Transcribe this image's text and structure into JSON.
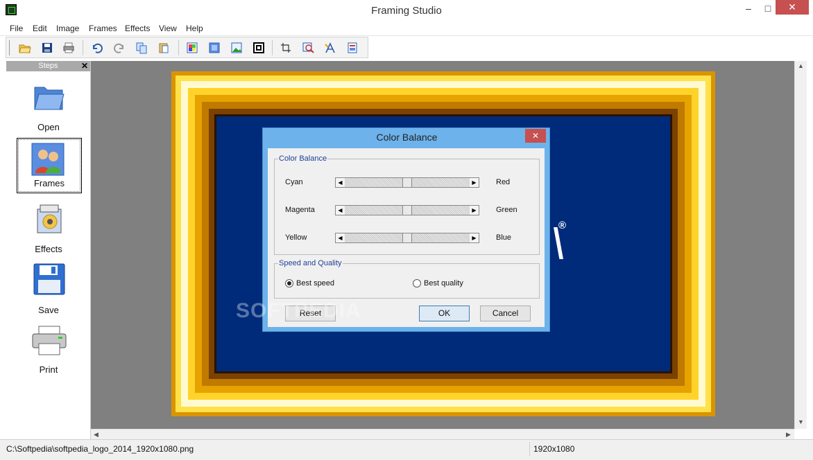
{
  "window": {
    "title": "Framing Studio",
    "min_glyph": "–",
    "max_glyph": "□",
    "close_glyph": "✕"
  },
  "menu": [
    "File",
    "Edit",
    "Image",
    "Frames",
    "Effects",
    "View",
    "Help"
  ],
  "steps": {
    "title": "Steps",
    "close_glyph": "✕",
    "items": [
      {
        "label": "Open"
      },
      {
        "label": "Frames"
      },
      {
        "label": "Effects"
      },
      {
        "label": "Save"
      },
      {
        "label": "Print"
      }
    ]
  },
  "dialog": {
    "title": "Color Balance",
    "close_glyph": "✕",
    "color_group_title": "Color Balance",
    "sliders": [
      {
        "left": "Cyan",
        "right": "Red",
        "value": 0.5
      },
      {
        "left": "Magenta",
        "right": "Green",
        "value": 0.5
      },
      {
        "left": "Yellow",
        "right": "Blue",
        "value": 0.5
      }
    ],
    "speed_group_title": "Speed and Quality",
    "options": [
      {
        "label": "Best speed",
        "selected": true
      },
      {
        "label": "Best quality",
        "selected": false
      }
    ],
    "reset_label": "Reset",
    "ok_label": "OK",
    "cancel_label": "Cancel"
  },
  "watermark": "SOFTPEDIA",
  "image_mark": "®",
  "status": {
    "path": "C:\\Softpedia\\softpedia_logo_2014_1920x1080.png",
    "dimensions": "1920x1080"
  }
}
